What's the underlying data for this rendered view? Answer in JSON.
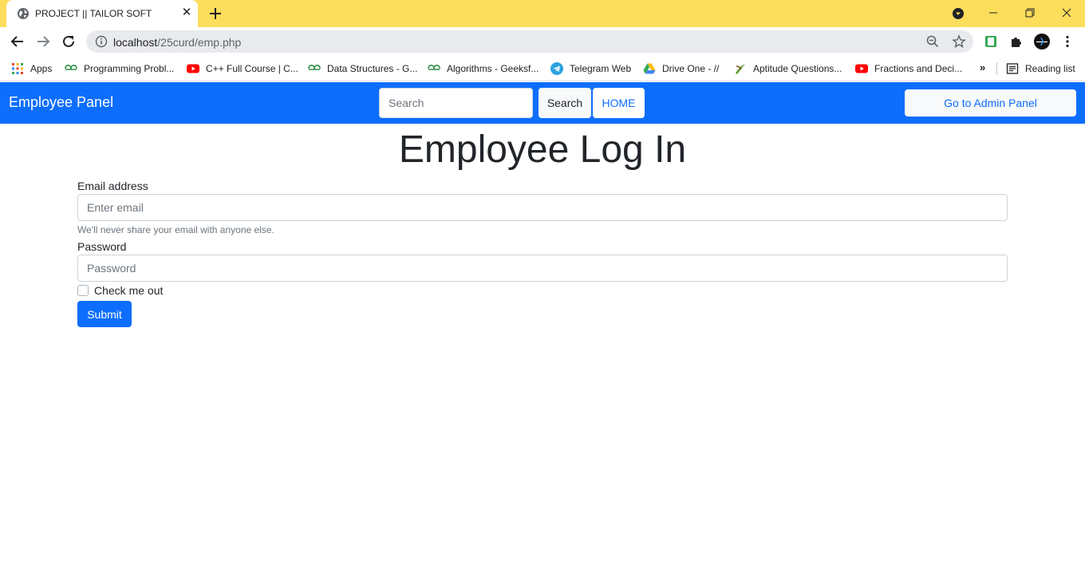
{
  "browser": {
    "tab": {
      "title": "PROJECT || TAILOR SOFT",
      "favicon": "globe-icon"
    },
    "url": {
      "host": "localhost",
      "path": "/25curd/emp.php"
    },
    "bookmarks": [
      {
        "label": "Apps",
        "icon": "apps-grid-icon"
      },
      {
        "label": "Programming Probl...",
        "icon": "geeksforgeeks-icon"
      },
      {
        "label": "C++ Full Course | C...",
        "icon": "youtube-icon"
      },
      {
        "label": "Data Structures - G...",
        "icon": "geeksforgeeks-icon"
      },
      {
        "label": "Algorithms - Geeksf...",
        "icon": "geeksforgeeks-icon"
      },
      {
        "label": "Telegram Web",
        "icon": "telegram-icon"
      },
      {
        "label": "Drive One - //",
        "icon": "google-drive-icon"
      },
      {
        "label": "Aptitude Questions...",
        "icon": "indiabix-icon"
      },
      {
        "label": "Fractions and Deci...",
        "icon": "youtube-icon"
      }
    ],
    "more_bookmarks": "»",
    "reading_list": "Reading list",
    "colors": {
      "tabstrip": "#fddd5c"
    }
  },
  "navbar": {
    "brand": "Employee Panel",
    "search_placeholder": "Search",
    "search_button": "Search",
    "home_button": "HOME",
    "admin_button": "Go to Admin Panel",
    "colors": {
      "background": "#0d6efd"
    }
  },
  "form": {
    "title": "Employee Log In",
    "email_label": "Email address",
    "email_placeholder": "Enter email",
    "email_help": "We'll never share your email with anyone else.",
    "password_label": "Password",
    "password_placeholder": "Password",
    "checkbox_label": "Check me out",
    "submit": "Submit"
  }
}
